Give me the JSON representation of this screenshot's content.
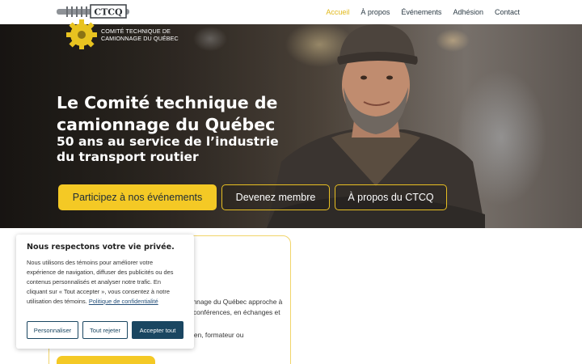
{
  "logo": {
    "badge": "CTCQ",
    "line1": "Comité technique de",
    "line2": "camionnage du Québec"
  },
  "nav": {
    "items": [
      "Accueil",
      "À propos",
      "Événements",
      "Adhésion",
      "Contact"
    ],
    "active_color": "#e1b819"
  },
  "hero": {
    "title": "Le Comité technique de camionnage du Québec",
    "subtitle": "50 ans au service de l’industrie du transport routier",
    "buttons": [
      "Participez à nos événements",
      "Devenez membre",
      "À propos du CTCQ"
    ]
  },
  "content": {
    "line1": "ionnage du Québec approche à",
    "line2": "n conférences, en échanges et",
    "line3": "icien, formateur ou"
  },
  "cookie": {
    "title": "Nous respectons votre vie privée.",
    "body": "Nous utilisons des témoins pour améliorer votre expérience de navigation, diffuser des publicités ou des contenus personnalisés et analyser notre trafic. En cliquant sur « Tout accepter », vous consentez à notre utilisation des témoins.",
    "link": "Politique de confidentialité",
    "buttons": {
      "customize": "Personnaliser",
      "reject": "Tout rejeter",
      "accept": "Accepter tout"
    }
  },
  "colors": {
    "accent": "#f4c925",
    "navy": "#1a4661"
  }
}
